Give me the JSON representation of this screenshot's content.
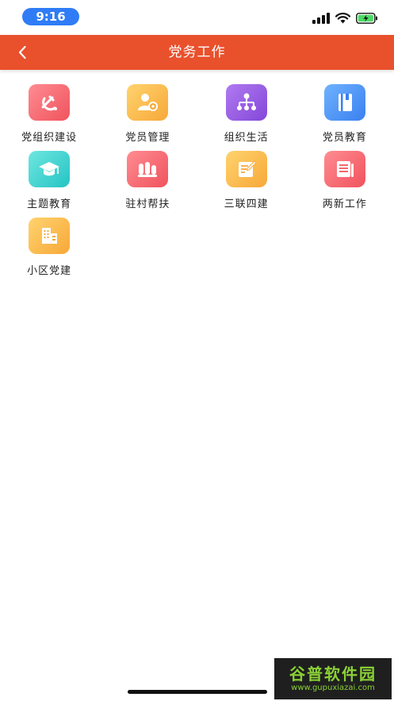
{
  "status_bar": {
    "time": "9:16"
  },
  "header": {
    "title": "党务工作"
  },
  "colors": {
    "header_bg": "#e9502c",
    "time_pill": "#2f7cf6"
  },
  "grid": {
    "items": [
      {
        "label": "党组织建设",
        "icon": "party-emblem-icon",
        "color_from": "#ff8c92",
        "color_to": "#f0535d"
      },
      {
        "label": "党员管理",
        "icon": "member-settings-icon",
        "color_from": "#ffd36e",
        "color_to": "#f7a838"
      },
      {
        "label": "组织生活",
        "icon": "org-chart-icon",
        "color_from": "#b07af0",
        "color_to": "#8447d9"
      },
      {
        "label": "党员教育",
        "icon": "notebook-icon",
        "color_from": "#6fb2ff",
        "color_to": "#3a80f0"
      },
      {
        "label": "主题教育",
        "icon": "graduation-cap-icon",
        "color_from": "#6fe6e0",
        "color_to": "#24c4c4"
      },
      {
        "label": "驻村帮扶",
        "icon": "people-group-icon",
        "color_from": "#ff8c92",
        "color_to": "#f0535d"
      },
      {
        "label": "三联四建",
        "icon": "note-edit-icon",
        "color_from": "#ffd36e",
        "color_to": "#f7a838"
      },
      {
        "label": "两新工作",
        "icon": "document-list-icon",
        "color_from": "#ff8c92",
        "color_to": "#f0535d"
      },
      {
        "label": "小区党建",
        "icon": "building-icon",
        "color_from": "#ffd36e",
        "color_to": "#f7a838"
      }
    ]
  },
  "watermark": {
    "brand": "谷普软件园",
    "url": "www.gupuxiazai.com"
  }
}
